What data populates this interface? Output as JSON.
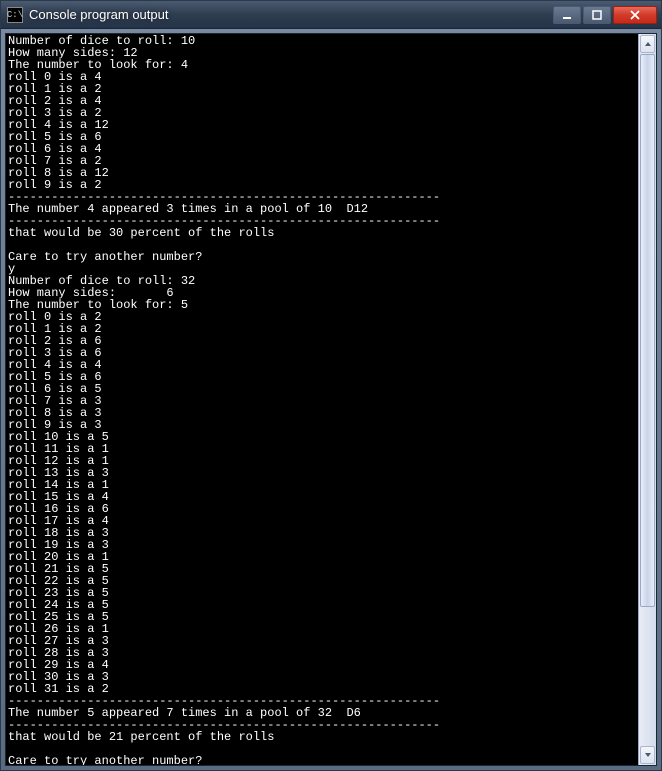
{
  "window": {
    "title": "Console program output",
    "icon_label": "C:\\"
  },
  "console": {
    "run1": {
      "dice_count_prompt": "Number of dice to roll:",
      "dice_count": "10",
      "sides_prompt": "How many sides:",
      "sides": "12",
      "look_for_prompt": "The number to look for:",
      "look_for": "4",
      "rolls": [
        {
          "i": "0",
          "v": "4"
        },
        {
          "i": "1",
          "v": "2"
        },
        {
          "i": "2",
          "v": "4"
        },
        {
          "i": "3",
          "v": "2"
        },
        {
          "i": "4",
          "v": "12"
        },
        {
          "i": "5",
          "v": "6"
        },
        {
          "i": "6",
          "v": "4"
        },
        {
          "i": "7",
          "v": "2"
        },
        {
          "i": "8",
          "v": "12"
        },
        {
          "i": "9",
          "v": "2"
        }
      ],
      "result_number": "4",
      "result_times": "3",
      "result_pool": "10",
      "result_die": "D12",
      "percent": "30",
      "try_again_prompt": "Care to try another number?",
      "try_again_answer": "y"
    },
    "run2": {
      "dice_count_prompt": "Number of dice to roll:",
      "dice_count": "32",
      "sides_prompt": "How many sides:",
      "sides": "6",
      "look_for_prompt": "The number to look for:",
      "look_for": "5",
      "rolls": [
        {
          "i": "0",
          "v": "2"
        },
        {
          "i": "1",
          "v": "2"
        },
        {
          "i": "2",
          "v": "6"
        },
        {
          "i": "3",
          "v": "6"
        },
        {
          "i": "4",
          "v": "4"
        },
        {
          "i": "5",
          "v": "6"
        },
        {
          "i": "6",
          "v": "5"
        },
        {
          "i": "7",
          "v": "3"
        },
        {
          "i": "8",
          "v": "3"
        },
        {
          "i": "9",
          "v": "3"
        },
        {
          "i": "10",
          "v": "5"
        },
        {
          "i": "11",
          "v": "1"
        },
        {
          "i": "12",
          "v": "1"
        },
        {
          "i": "13",
          "v": "3"
        },
        {
          "i": "14",
          "v": "1"
        },
        {
          "i": "15",
          "v": "4"
        },
        {
          "i": "16",
          "v": "6"
        },
        {
          "i": "17",
          "v": "4"
        },
        {
          "i": "18",
          "v": "3"
        },
        {
          "i": "19",
          "v": "3"
        },
        {
          "i": "20",
          "v": "1"
        },
        {
          "i": "21",
          "v": "5"
        },
        {
          "i": "22",
          "v": "5"
        },
        {
          "i": "23",
          "v": "5"
        },
        {
          "i": "24",
          "v": "5"
        },
        {
          "i": "25",
          "v": "5"
        },
        {
          "i": "26",
          "v": "1"
        },
        {
          "i": "27",
          "v": "3"
        },
        {
          "i": "28",
          "v": "3"
        },
        {
          "i": "29",
          "v": "4"
        },
        {
          "i": "30",
          "v": "3"
        },
        {
          "i": "31",
          "v": "2"
        }
      ],
      "result_number": "5",
      "result_times": "7",
      "result_pool": "32",
      "result_die": "D6",
      "percent": "21",
      "try_again_prompt": "Care to try another number?"
    },
    "separator": "------------------------------------------------------------",
    "roll_word": "roll",
    "is_a": "is a",
    "result_tpl_a": "The number",
    "result_tpl_b": "appeared",
    "result_tpl_c": "times in a pool of",
    "percent_tpl_a": "that would be",
    "percent_tpl_b": "percent of the rolls"
  }
}
